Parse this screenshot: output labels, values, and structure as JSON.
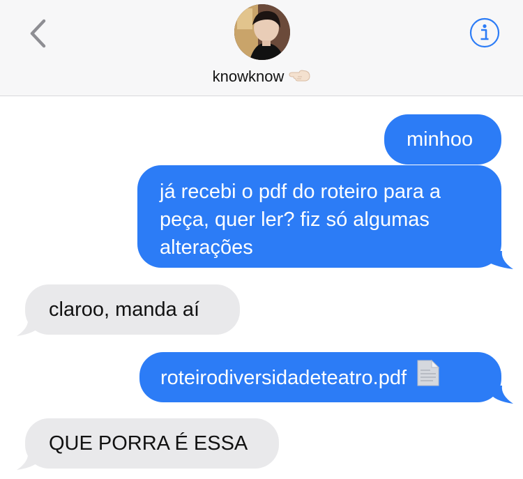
{
  "contact": {
    "name": "knowknow",
    "name_emoji": "hand-pointing-left-icon"
  },
  "colors": {
    "sent_bubble": "#2c7cf6",
    "received_bubble": "#e9e9eb",
    "accent": "#2c7cf6",
    "header_bg": "#f7f7f8"
  },
  "messages": [
    {
      "sender": "me",
      "text": "minhoo"
    },
    {
      "sender": "me",
      "lines": [
        "já recebi o pdf do roteiro para a",
        "peça, quer ler? fiz só algumas",
        "alterações"
      ]
    },
    {
      "sender": "contact",
      "text": "claroo, manda aí"
    },
    {
      "sender": "me",
      "text": "roteirodiversidadeteatro.pdf",
      "attachment_icon": "document-icon"
    },
    {
      "sender": "contact",
      "text": "QUE PORRA É ESSA"
    }
  ]
}
